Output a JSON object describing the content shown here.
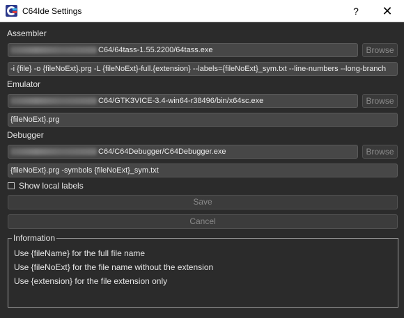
{
  "window": {
    "title": "C64Ide Settings",
    "help_label": "?",
    "close_label": "✕"
  },
  "assembler": {
    "label": "Assembler",
    "path_value": "C64/64tass-1.55.2200/64tass.exe",
    "args_value": "-i {file} -o {fileNoExt}.prg -L {fileNoExt}-full.{extension}  --labels={fileNoExt}_sym.txt --line-numbers --long-branch",
    "browse_label": "Browse"
  },
  "emulator": {
    "label": "Emulator",
    "path_value": "C64/GTK3VICE-3.4-win64-r38496/bin/x64sc.exe",
    "args_value": "{fileNoExt}.prg",
    "browse_label": "Browse"
  },
  "debugger": {
    "label": "Debugger",
    "path_value": "C64/C64Debugger/C64Debugger.exe",
    "args_value": "{fileNoExt}.prg -symbols {fileNoExt}_sym.txt",
    "browse_label": "Browse"
  },
  "options": {
    "show_local_labels": "Show local labels",
    "show_local_labels_checked": false
  },
  "actions": {
    "save_label": "Save",
    "cancel_label": "Cancel"
  },
  "information": {
    "title": "Information",
    "lines": [
      "Use {fileName} for the full file name",
      "Use {fileNoExt} for the file name without the extension",
      "Use {extension} for the file extension only"
    ]
  },
  "colors": {
    "background": "#2b2b2b",
    "field_background": "#474747",
    "title_bar": "#ffffff"
  }
}
